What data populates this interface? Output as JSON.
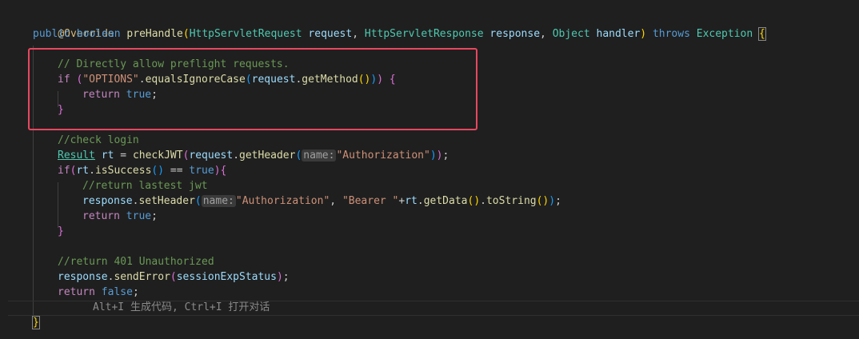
{
  "code": {
    "l1": {
      "annotation": "@Override"
    },
    "l2": {
      "kw_public": "public",
      "kw_boolean": "boolean",
      "fn": "preHandle",
      "open": "(",
      "type1": "HttpServletRequest",
      "var1": "request",
      "comma1": ",",
      "type2": "HttpServletResponse",
      "var2": "response",
      "comma2": ",",
      "type3": "Object",
      "var3": "handler",
      "close": ")",
      "kw_throws": "throws",
      "type4": "Exception",
      "brace": "{"
    },
    "l3": {
      "comment": "// Directly allow preflight requests."
    },
    "l4": {
      "kw_if": "if",
      "p1": "(",
      "str": "\"OPTIONS\"",
      "dot": ".",
      "fn1": "equalsIgnoreCase",
      "p2": "(",
      "var": "request",
      "dot2": ".",
      "fn2": "getMethod",
      "p3": "()",
      "p4": ")",
      "p5": ")",
      "brace": "{"
    },
    "l5": {
      "kw_return": "return",
      "kw_true": "true",
      "semi": ";"
    },
    "l6": {
      "brace": "}"
    },
    "l7": {
      "comment": "//check login"
    },
    "l8": {
      "type": "Result",
      "var": "rt",
      "eq": "=",
      "fn1": "checkJWT",
      "p1": "(",
      "var2": "request",
      "dot": ".",
      "fn2": "getHeader",
      "p2": "(",
      "hint": "name:",
      "str": "\"Authorization\"",
      "p3": ")",
      "p4": ")",
      "semi": ";"
    },
    "l9": {
      "kw_if": "if",
      "p1": "(",
      "var": "rt",
      "dot": ".",
      "fn": "isSuccess",
      "p2": "()",
      "eq": "==",
      "kw_true": "true",
      "p3": ")",
      "brace": "{"
    },
    "l10": {
      "comment": "//return lastest jwt"
    },
    "l11": {
      "var": "response",
      "dot": ".",
      "fn": "setHeader",
      "p1": "(",
      "hint": "name:",
      "str1": "\"Authorization\"",
      "comma": ",",
      "str2": "\"Bearer \"",
      "plus": "+",
      "var2": "rt",
      "dot2": ".",
      "fn2": "getData",
      "p2": "()",
      "dot3": ".",
      "fn3": "toString",
      "p3": "()",
      "p4": ")",
      "semi": ";"
    },
    "l12": {
      "kw_return": "return",
      "kw_true": "true",
      "semi": ";"
    },
    "l13": {
      "brace": "}"
    },
    "l14": {
      "comment": "//return 401 Unauthorized"
    },
    "l15": {
      "var": "response",
      "dot": ".",
      "fn": "sendError",
      "p1": "(",
      "var2": "sessionExpStatus",
      "p2": ")",
      "semi": ";"
    },
    "l16": {
      "kw_return": "return",
      "kw_false": "false",
      "semi": ";"
    },
    "l17": {
      "ghost": "Alt+I 生成代码, Ctrl+I 打开对话"
    },
    "l18": {
      "brace": "}"
    }
  },
  "colors": {
    "background": "#1f1f1f",
    "highlight_border": "#e8475f",
    "keyword": "#569cd6",
    "control": "#c586c0",
    "function": "#dcdcaa",
    "type": "#4ec9b0",
    "variable": "#9cdcfe",
    "string": "#ce9178",
    "comment": "#6a9955"
  }
}
